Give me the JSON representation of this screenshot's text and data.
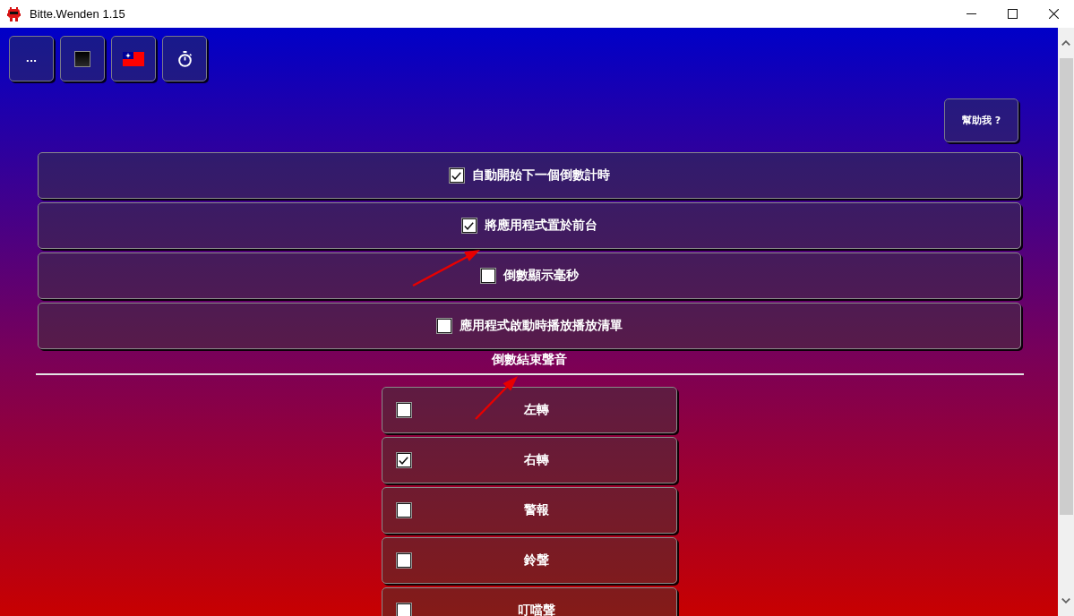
{
  "window": {
    "title": "Bitte.Wenden 1.15"
  },
  "toolbar": [
    {
      "kind": "text",
      "label": "..."
    },
    {
      "kind": "swatch"
    },
    {
      "kind": "flag"
    },
    {
      "kind": "timer"
    }
  ],
  "help_button": {
    "label": "幫助我 ?"
  },
  "options": [
    {
      "label": "自動開始下一個倒數計時",
      "checked": true
    },
    {
      "label": "將應用程式置於前台",
      "checked": true
    },
    {
      "label": "倒數顯示毫秒",
      "checked": false
    },
    {
      "label": "應用程式啟動時播放播放清單",
      "checked": false
    }
  ],
  "sound_section": {
    "title": "倒數結束聲音",
    "sounds": [
      {
        "label": "左轉",
        "checked": false
      },
      {
        "label": "右轉",
        "checked": true
      },
      {
        "label": "警報",
        "checked": false
      },
      {
        "label": "鈴聲",
        "checked": false
      },
      {
        "label": "叮噹聲",
        "checked": false
      }
    ]
  }
}
